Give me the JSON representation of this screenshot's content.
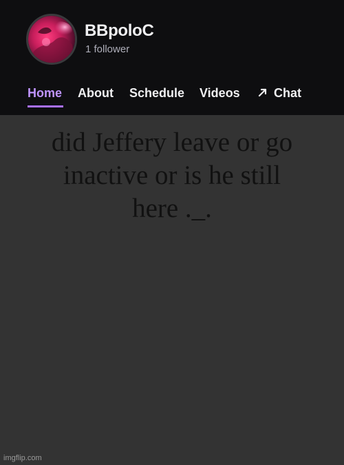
{
  "channel": {
    "name": "BBpoloC",
    "followers": "1 follower",
    "avatar_icon": "avatar-image"
  },
  "nav": {
    "tabs": [
      {
        "label": "Home",
        "active": true
      },
      {
        "label": "About",
        "active": false
      },
      {
        "label": "Schedule",
        "active": false
      },
      {
        "label": "Videos",
        "active": false
      },
      {
        "label": "Chat",
        "active": false,
        "icon": "popout-arrow-icon"
      }
    ]
  },
  "post": {
    "text": "did Jeffery leave or go inactive or is he still here ._."
  },
  "watermark": "imgflip.com",
  "colors": {
    "accent": "#bf94ff",
    "header_bg": "#0e0e10",
    "body_bg": "#333333"
  }
}
